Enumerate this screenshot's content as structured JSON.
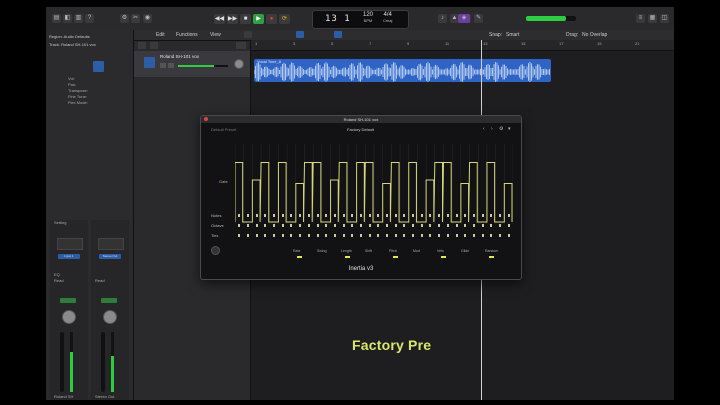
{
  "lcd": {
    "bar": "13",
    "beat": "1",
    "tempo": "120",
    "tempo_label": "BPM",
    "key": "Cmaj",
    "sig": "4/4"
  },
  "transport": {
    "rewind": "◀◀",
    "forward": "▶▶",
    "stop": "■",
    "play": "▶",
    "record": "●",
    "cycle": "⟳"
  },
  "inspector": {
    "region_label": "Region: Audio Defaults",
    "track_label": "Track: Roland SH-101 vox",
    "rows": [
      "Vol:",
      "Pan:",
      "Transpose:",
      "Fine Tune:",
      "Flex Mode:"
    ],
    "setting_label": "Setting",
    "strip1_name": "Roland SH",
    "strip2_name": "Stereo Out",
    "eq_label": "EQ",
    "input_label": "Input 1",
    "group_label": "Stereo Out",
    "read_label": "Read",
    "read2_label": "Read"
  },
  "arrange_bar": {
    "edit": "Edit",
    "functions": "Functions",
    "view": "View",
    "snap": "Snap:",
    "snap_val": "Smart",
    "drag": "Drag:",
    "drag_val": "No Overlap"
  },
  "ruler": [
    "1",
    "3",
    "5",
    "7",
    "9",
    "11",
    "13",
    "15",
    "17",
    "19",
    "21"
  ],
  "track": {
    "name": "Roland SH-101 vox"
  },
  "region": {
    "name": "Vocal Tone_8"
  },
  "factory_text": "Factory Pre",
  "plugin": {
    "title": "Roland SH-101 vox",
    "preset": "Factory Default",
    "header_left": "Default Preset",
    "gate_label": "Gate",
    "step_labels": [
      "Notes",
      "Octave",
      "Ties"
    ],
    "bottom_controls": [
      "Rate",
      "Swing",
      "Length",
      "Shift",
      "Pitch",
      "Mod",
      "Velo",
      "Glide",
      "Random"
    ],
    "plugin_name": "Inertia v3"
  },
  "gate_heights": [
    0.85,
    0.0,
    0.6,
    0.85,
    0.0,
    0.85,
    0.0,
    0.55,
    0.85,
    0.85,
    0.0,
    0.6,
    0.85,
    0.0,
    0.85,
    0.85,
    0.0,
    0.55,
    0.85,
    0.0,
    0.85,
    0.0,
    0.6,
    0.85,
    0.85,
    0.0,
    0.55,
    0.85,
    0.0,
    0.85,
    0.0,
    0.55
  ],
  "colors": {
    "accent_green": "#2ecc40",
    "region_blue": "#2f63c4",
    "gate_line": "#d6d67a",
    "factory_text": "#d8e86a",
    "record_red": "#e0443e"
  }
}
